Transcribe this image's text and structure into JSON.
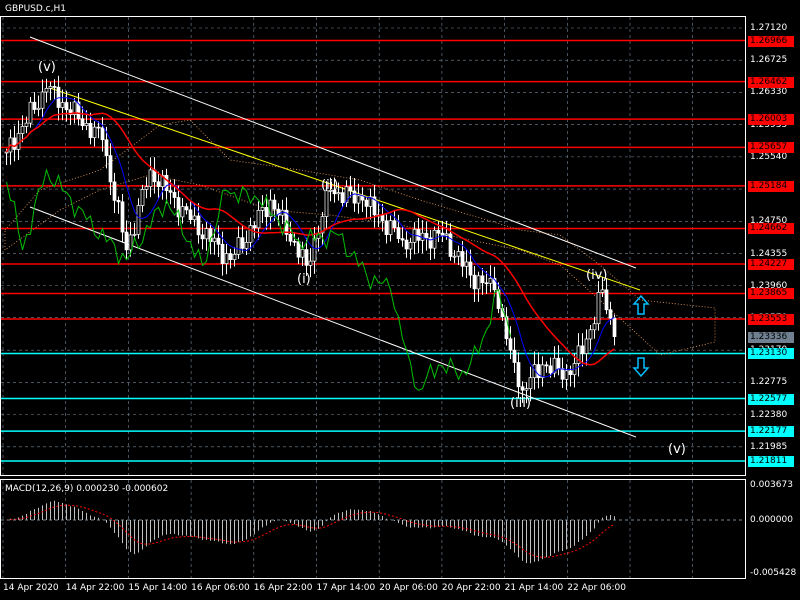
{
  "title": "GBPUSD.c,H1",
  "colors": {
    "resistance": "#ff0000",
    "support": "#00ffff",
    "candle": "#ffffff",
    "ma_fast": "#0000ff",
    "ma_slow": "#ff0000",
    "lagging": "#00c000",
    "trend": "#ffff00"
  },
  "chart_data": {
    "type": "candlestick",
    "symbol": "GBPUSD.c",
    "timeframe": "H1",
    "price_ticks": [
      "1.27120",
      "1.26725",
      "1.26330",
      "1.25935",
      "1.25540",
      "1.25145",
      "1.24750",
      "1.24355",
      "1.23960",
      "1.23570",
      "1.23170",
      "1.22775",
      "1.22380",
      "1.21985"
    ],
    "ylim": [
      1.2145,
      1.275
    ],
    "time_labels": [
      "14 Apr 2020",
      "14 Apr 22:00",
      "15 Apr 14:00",
      "16 Apr 06:00",
      "16 Apr 22:00",
      "17 Apr 14:00",
      "20 Apr 06:00",
      "20 Apr 22:00",
      "21 Apr 14:00",
      "22 Apr 06:00"
    ],
    "close_waypoints": [
      [
        0,
        1.256
      ],
      [
        10,
        1.2638
      ],
      [
        24,
        1.2575
      ],
      [
        30,
        1.244
      ],
      [
        36,
        1.2538
      ],
      [
        46,
        1.2477
      ],
      [
        56,
        1.2428
      ],
      [
        66,
        1.2501
      ],
      [
        75,
        1.2421
      ],
      [
        81,
        1.2513
      ],
      [
        89,
        1.2501
      ],
      [
        99,
        1.2452
      ],
      [
        109,
        1.2458
      ],
      [
        116,
        1.2409
      ],
      [
        122,
        1.2391
      ],
      [
        126,
        1.2317
      ],
      [
        129,
        1.2268
      ],
      [
        134,
        1.2299
      ],
      [
        141,
        1.2287
      ],
      [
        146,
        1.2342
      ],
      [
        149,
        1.2391
      ],
      [
        152,
        1.23336
      ]
    ],
    "resistance_levels": [
      "1.26966",
      "1.26462",
      "1.26003",
      "1.25657",
      "1.25184",
      "1.24662",
      "1.24227",
      "1.23865",
      "1.23553"
    ],
    "support_levels": [
      "1.23130",
      "1.22577",
      "1.22177",
      "1.21811"
    ],
    "current_price": "1.23336",
    "wave_labels": [
      "(v)",
      "(i)",
      "(ii)",
      "(iii)",
      "(iv)",
      "(v)"
    ],
    "macd": {
      "label": "MACD(12,26,9) 0.000230 -0.000602",
      "ticks": [
        "0.003673",
        "0.000000",
        "-0.005428"
      ],
      "ylim": [
        -0.005428,
        0.003673
      ]
    }
  }
}
